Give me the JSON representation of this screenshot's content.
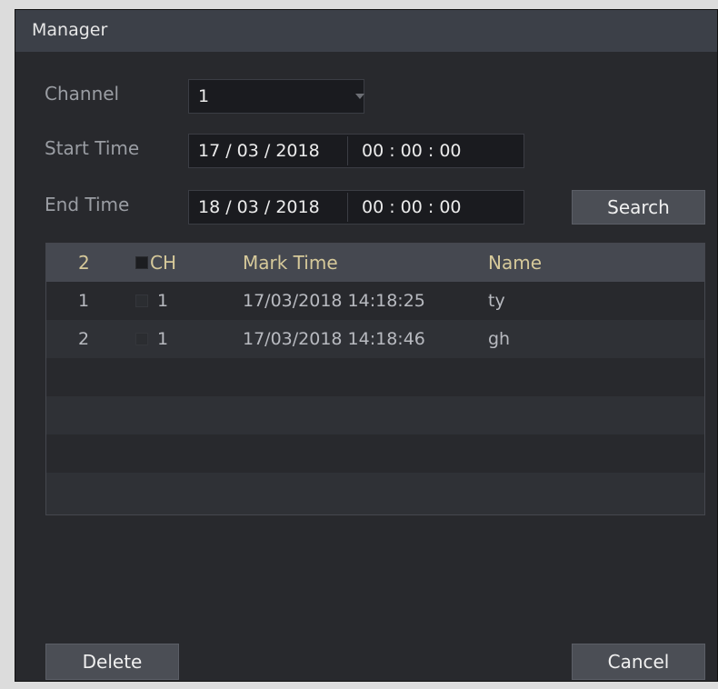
{
  "dialog": {
    "title": "Manager",
    "channel": {
      "label": "Channel",
      "value": "1"
    },
    "start_time": {
      "label": "Start Time",
      "date": "17 / 03 / 2018",
      "time": "00 : 00 : 00"
    },
    "end_time": {
      "label": "End Time",
      "date": "18 / 03 / 2018",
      "time": "00 : 00 : 00"
    },
    "search_label": "Search",
    "table": {
      "count": "2",
      "headers": {
        "ch": "CH",
        "mark_time": "Mark Time",
        "name": "Name"
      },
      "rows": [
        {
          "index": "1",
          "ch": "1",
          "mark_time": "17/03/2018 14:18:25",
          "name": "ty"
        },
        {
          "index": "2",
          "ch": "1",
          "mark_time": "17/03/2018 14:18:46",
          "name": "gh"
        }
      ]
    },
    "delete_label": "Delete",
    "cancel_label": "Cancel"
  }
}
